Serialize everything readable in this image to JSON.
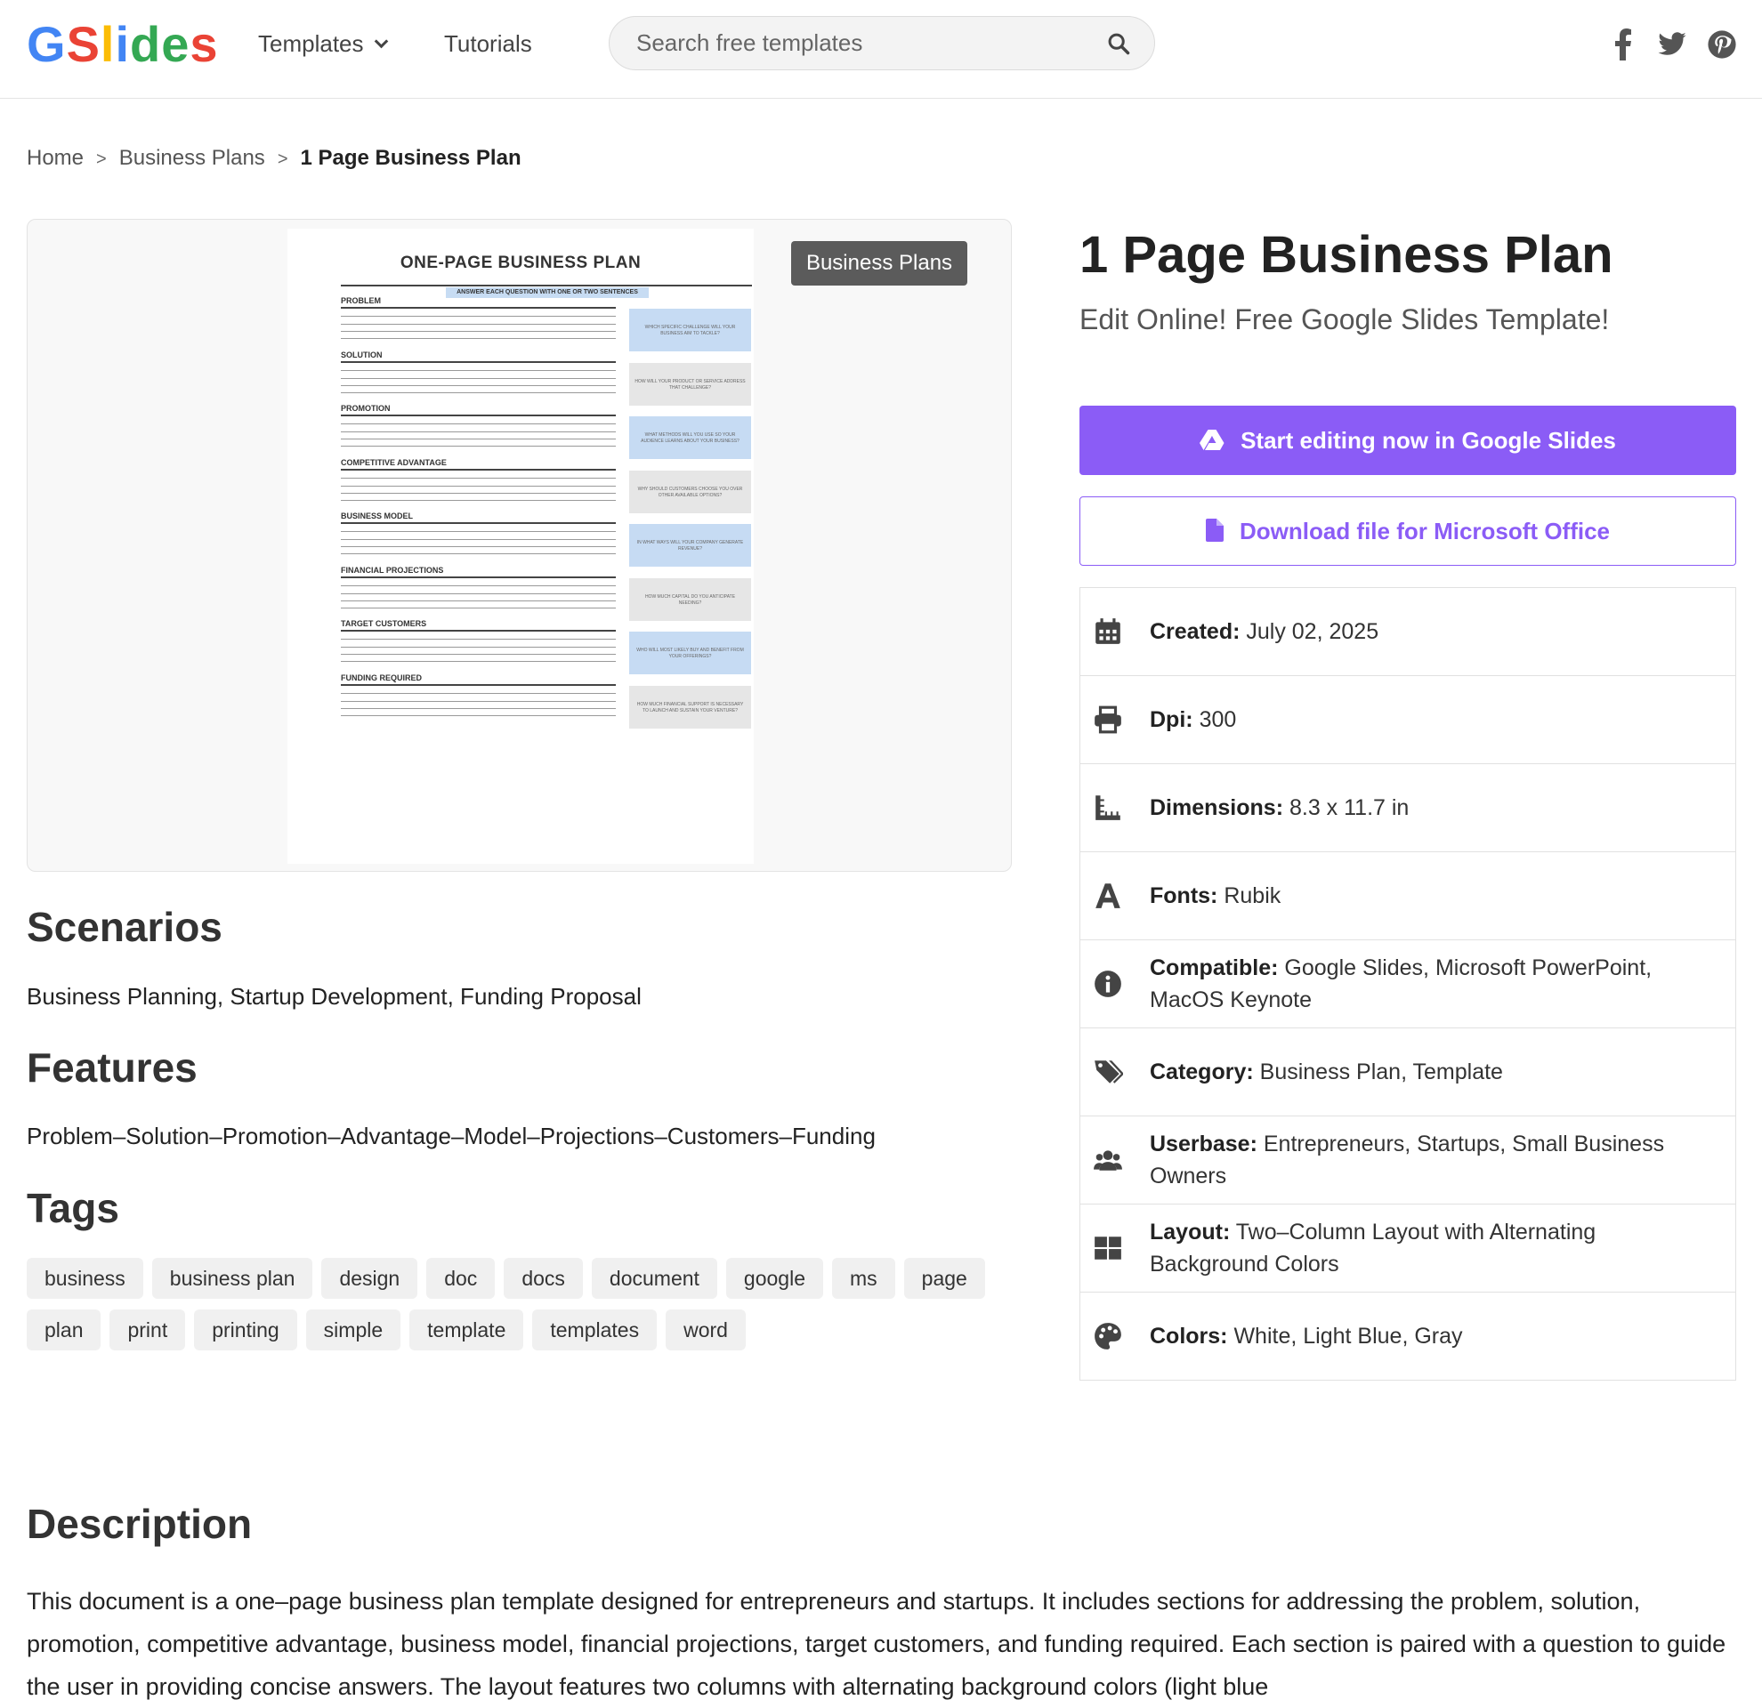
{
  "header": {
    "logo_letters": [
      "G",
      "S",
      "l",
      "i",
      "d",
      "e",
      "s"
    ],
    "logo_colors": [
      "#4285F4",
      "#EA4335",
      "#FBBC05",
      "#4285F4",
      "#34A853",
      "#34A853",
      "#EA4335"
    ],
    "nav": {
      "templates": "Templates",
      "tutorials": "Tutorials"
    },
    "search_placeholder": "Search free templates",
    "social": [
      "facebook-icon",
      "twitter-icon",
      "pinterest-icon"
    ]
  },
  "breadcrumb": {
    "home": "Home",
    "category": "Business Plans",
    "current": "1 Page Business Plan"
  },
  "preview": {
    "badge": "Business Plans",
    "doc_title": "ONE-PAGE BUSINESS PLAN",
    "doc_subtitle": "ANSWER EACH QUESTION WITH ONE OR TWO SENTENCES",
    "sections": [
      {
        "label": "PROBLEM",
        "question": "WHICH SPECIFIC CHALLENGE WILL YOUR BUSINESS AIM TO TACKLE?"
      },
      {
        "label": "SOLUTION",
        "question": "HOW WILL YOUR PRODUCT OR SERVICE ADDRESS THAT CHALLENGE?"
      },
      {
        "label": "PROMOTION",
        "question": "WHAT METHODS WILL YOU USE SO YOUR AUDIENCE LEARNS ABOUT YOUR BUSINESS?"
      },
      {
        "label": "COMPETITIVE ADVANTAGE",
        "question": "WHY SHOULD CUSTOMERS CHOOSE YOU OVER OTHER AVAILABLE OPTIONS?"
      },
      {
        "label": "BUSINESS MODEL",
        "question": "IN WHAT WAYS WILL YOUR COMPANY GENERATE REVENUE?"
      },
      {
        "label": "FINANCIAL PROJECTIONS",
        "question": "HOW MUCH CAPITAL DO YOU ANTICIPATE NEEDING?"
      },
      {
        "label": "TARGET CUSTOMERS",
        "question": "WHO WILL MOST LIKELY BUY AND BENEFIT FROM YOUR OFFERINGS?"
      },
      {
        "label": "FUNDING REQUIRED",
        "question": "HOW MUCH FINANCIAL SUPPORT IS NECESSARY TO LAUNCH AND SUSTAIN YOUR VENTURE?"
      }
    ]
  },
  "main": {
    "scenarios_heading": "Scenarios",
    "scenarios_text": "Business Planning, Startup Development, Funding Proposal",
    "features_heading": "Features",
    "features_text": "Problem–Solution–Promotion–Advantage–Model–Projections–Customers–Funding",
    "tags_heading": "Tags",
    "tags": [
      "business",
      "business plan",
      "design",
      "doc",
      "docs",
      "document",
      "google",
      "ms",
      "page",
      "plan",
      "print",
      "printing",
      "simple",
      "template",
      "templates",
      "word"
    ]
  },
  "details": {
    "title": "1 Page Business Plan",
    "subtitle": "Edit Online! Free Google Slides Template!",
    "primary_button": "Start editing now in Google Slides",
    "secondary_button": "Download file for Microsoft Office",
    "accent_color": "#8b5cf6",
    "meta": [
      {
        "icon": "calendar-icon",
        "label": "Created:",
        "value": "July 02, 2025"
      },
      {
        "icon": "printer-icon",
        "label": "Dpi:",
        "value": "300"
      },
      {
        "icon": "ruler-icon",
        "label": "Dimensions:",
        "value": "8.3 x 11.7 in"
      },
      {
        "icon": "font-icon",
        "label": "Fonts:",
        "value": "Rubik"
      },
      {
        "icon": "info-icon",
        "label": "Compatible:",
        "value": "Google Slides, Microsoft PowerPoint, MacOS Keynote"
      },
      {
        "icon": "tags-icon",
        "label": "Category:",
        "value": "Business Plan, Template"
      },
      {
        "icon": "users-icon",
        "label": "Userbase:",
        "value": "Entrepreneurs, Startups, Small Business Owners"
      },
      {
        "icon": "layout-icon",
        "label": "Layout:",
        "value": "Two–Column Layout with Alternating Background Colors"
      },
      {
        "icon": "palette-icon",
        "label": "Colors:",
        "value": "White, Light Blue, Gray"
      }
    ]
  },
  "description": {
    "heading": "Description",
    "text": "This document is a one–page business plan template designed for entrepreneurs and startups. It includes sections for addressing the problem, solution, promotion, competitive advantage, business model, financial projections, target customers, and funding required. Each section is paired with a question to guide the user in providing concise answers. The layout features two columns with alternating background colors (light blue"
  }
}
